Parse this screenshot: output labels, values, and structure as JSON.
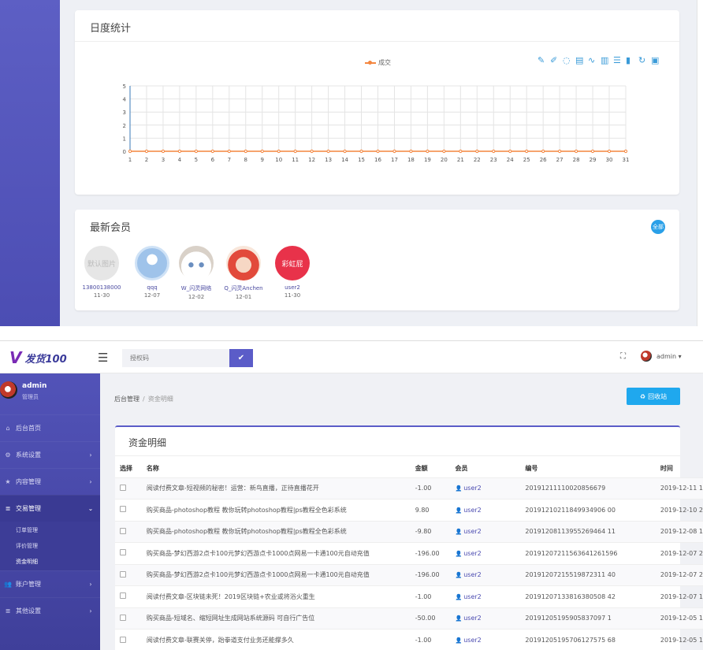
{
  "top": {
    "stats_card": {
      "title": "日度统计"
    },
    "members_card": {
      "title": "最新会员",
      "all_label": "全部"
    },
    "members": [
      {
        "name": "13800138000",
        "date": "11-30",
        "avatar": "default-placeholder",
        "avatar_text": "默认图片"
      },
      {
        "name": "qqq",
        "date": "12-07",
        "avatar": "blue-person"
      },
      {
        "name": "W_闪灵网络",
        "date": "12-02",
        "avatar": "white-cat"
      },
      {
        "name": "Q_闪灵Anchen",
        "date": "12-01",
        "avatar": "red-cartoon"
      },
      {
        "name": "user2",
        "date": "11-30",
        "avatar": "rainbow-text",
        "avatar_text": "彩虹屁"
      }
    ],
    "toolbox_icons": [
      "mark-icon",
      "mark-undo-icon",
      "mark-clear-icon",
      "data-view-icon",
      "line-chart-icon",
      "bar-chart-icon",
      "stack-icon",
      "tiled-icon",
      "restore-icon",
      "save-image-icon"
    ],
    "chart_data": {
      "type": "line",
      "series": [
        {
          "name": "成交",
          "values": [
            0,
            0,
            0,
            0,
            0,
            0,
            0,
            0,
            0,
            0,
            0,
            0,
            0,
            0,
            0,
            0,
            0,
            0,
            0,
            0,
            0,
            0,
            0,
            0,
            0,
            0,
            0,
            0,
            0,
            0,
            0
          ]
        }
      ],
      "x": [
        "1",
        "2",
        "3",
        "4",
        "5",
        "6",
        "7",
        "8",
        "9",
        "10",
        "11",
        "12",
        "13",
        "14",
        "15",
        "16",
        "17",
        "18",
        "19",
        "20",
        "21",
        "22",
        "23",
        "24",
        "25",
        "26",
        "27",
        "28",
        "29",
        "30",
        "31"
      ],
      "y_ticks": [
        "0",
        "1",
        "2",
        "3",
        "4",
        "5"
      ],
      "ylim": [
        0,
        5
      ],
      "grid": true,
      "legend": "top-center",
      "color": "#f4863f"
    }
  },
  "bottom": {
    "logo": {
      "mark": "V",
      "text": "发货100"
    },
    "auth_placeholder": "授权码",
    "admin_top": "admin ▾",
    "user": {
      "name": "admin",
      "role": "管理员"
    },
    "nav": [
      {
        "label": "后台首页",
        "icon": "home-icon"
      },
      {
        "label": "系统设置",
        "icon": "gear-icon",
        "chev": "›"
      },
      {
        "label": "内容管理",
        "icon": "star-icon",
        "chev": "›"
      },
      {
        "label": "交易管理",
        "icon": "list-icon",
        "chev": "⌄"
      },
      {
        "label": "账户管理",
        "icon": "user-group-icon",
        "chev": "›"
      },
      {
        "label": "其他设置",
        "icon": "list-icon",
        "chev": "›"
      }
    ],
    "sub_nav": [
      "订单管理",
      "评价管理",
      "资金明细"
    ],
    "breadcrumb": {
      "root": "后台管理",
      "sep": "/",
      "current": "资金明细"
    },
    "recycle_label": "回收站",
    "table": {
      "title": "资金明细",
      "headers": [
        "选择",
        "名称",
        "金额",
        "会员",
        "编号",
        "时间"
      ],
      "rows": [
        {
          "name": "阅读付费文章-短视频的秘密！运营：新鸟直播，正待直播花开",
          "amount": "-1.00",
          "user": "user2",
          "no": "20191211110020856679",
          "time": "2019-12-11 1"
        },
        {
          "name": "购买商品-photoshop教程 教你玩转photoshop教程|ps教程全色彩系统",
          "amount": "9.80",
          "user": "user2",
          "no": "20191210211849934906 00",
          "time": "2019-12-10 2"
        },
        {
          "name": "购买商品-photoshop教程 教你玩转photoshop教程|ps教程全色彩系统",
          "amount": "-9.80",
          "user": "user2",
          "no": "20191208113955269464 11",
          "time": "2019-12-08 1"
        },
        {
          "name": "购买商品-梦幻西游2点卡100元梦幻西游点卡1000点网易一卡通100元自动充值",
          "amount": "-196.00",
          "user": "user2",
          "no": "20191207211563641261596",
          "time": "2019-12-07 2"
        },
        {
          "name": "购买商品-梦幻西游2点卡100元梦幻西游点卡1000点网易一卡通100元自动充值",
          "amount": "-196.00",
          "user": "user2",
          "no": "20191207215519872311 40",
          "time": "2019-12-07 2"
        },
        {
          "name": "阅读付费文章-区块链未死！2019区块链+农业或将浴火重生",
          "amount": "-1.00",
          "user": "user2",
          "no": "20191207133816380508 42",
          "time": "2019-12-07 1"
        },
        {
          "name": "购买商品-短域名、缩短网址生成网站系统源码 可自行广告位",
          "amount": "-50.00",
          "user": "user2",
          "no": "20191205195905837097 1",
          "time": "2019-12-05 1"
        },
        {
          "name": "阅读付费文章-联赛关停，跆拳道支付业务还能撑多久",
          "amount": "-1.00",
          "user": "user2",
          "no": "20191205195706127575 68",
          "time": "2019-12-05 1"
        }
      ]
    }
  }
}
